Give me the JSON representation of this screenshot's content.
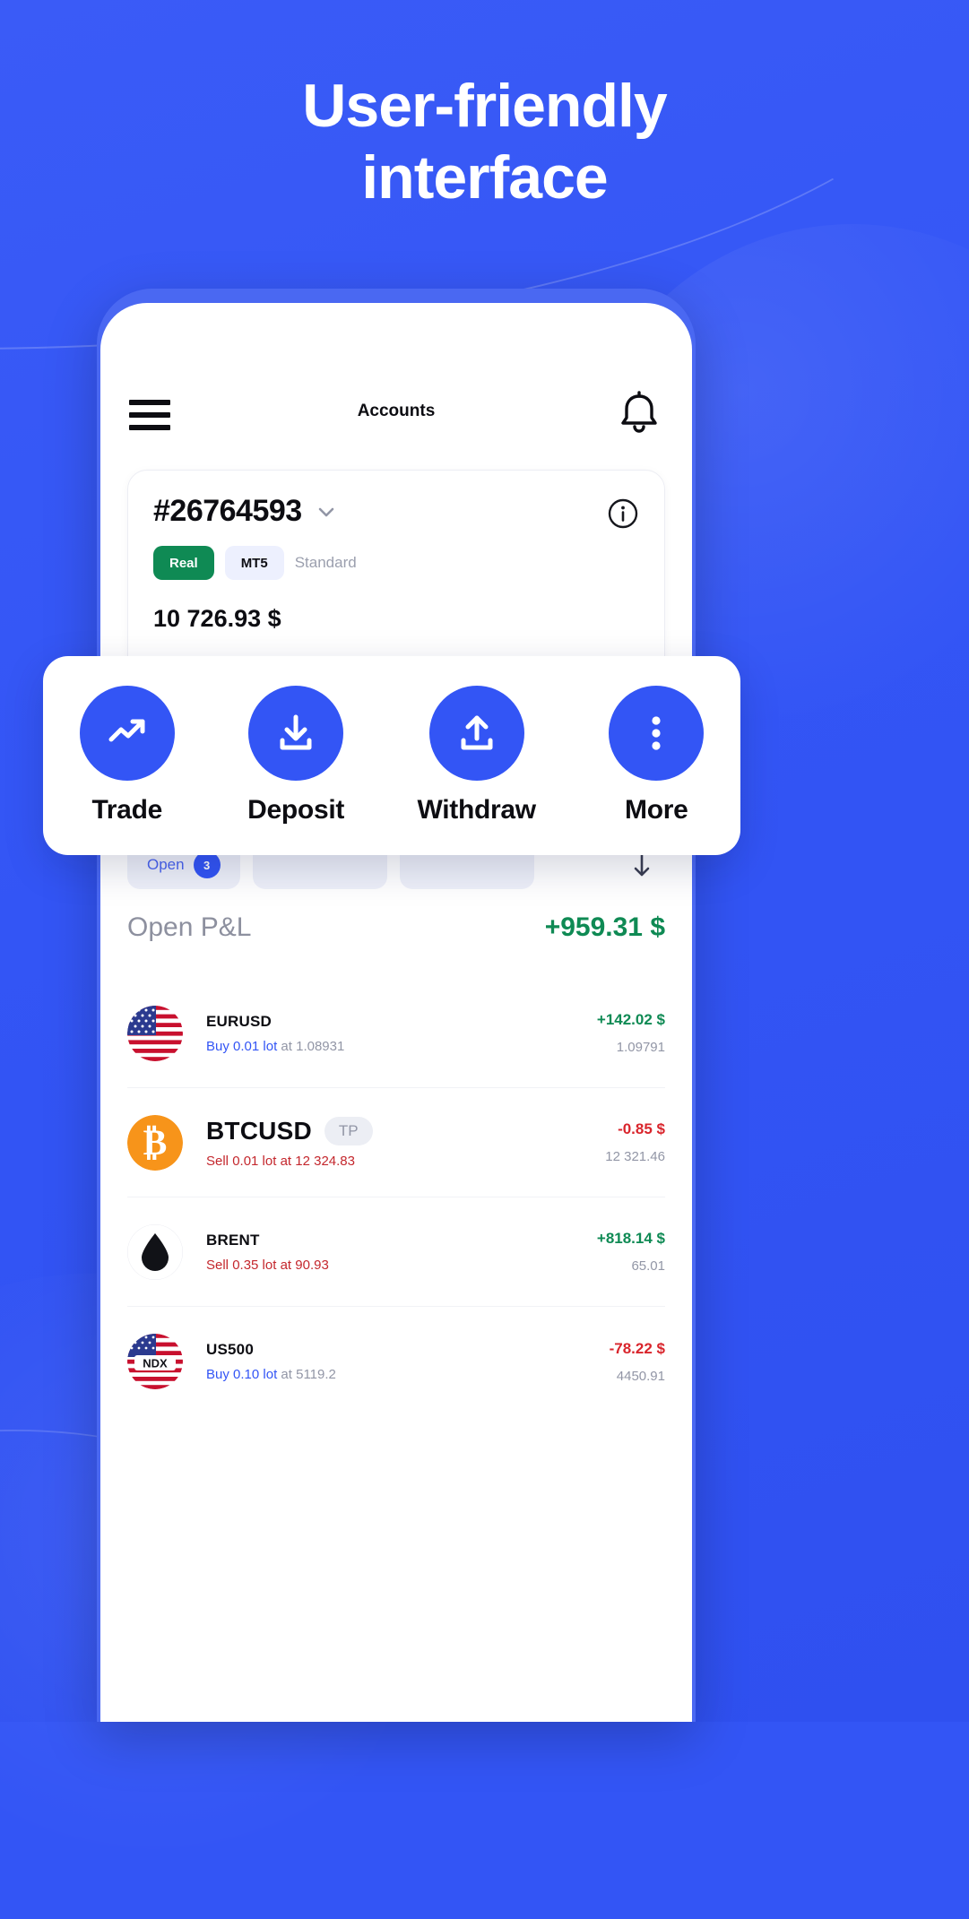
{
  "promo": {
    "headline_line1": "User-friendly",
    "headline_line2": "interface"
  },
  "appbar": {
    "title": "Accounts",
    "menu_icon": "hamburger-menu-icon",
    "bell_icon": "bell-icon"
  },
  "account": {
    "number": "#26764593",
    "chevron_icon": "chevron-down-icon",
    "info_icon": "info-circle-icon",
    "badge_real": "Real",
    "badge_platform": "MT5",
    "badge_type": "Standard",
    "balance": "10 726.93 $"
  },
  "tabs": [
    {
      "label": "Open",
      "count": "3"
    },
    {
      "label": "",
      "count": ""
    },
    {
      "label": "",
      "count": ""
    }
  ],
  "sort_icon": "sort-descending-icon",
  "actions": [
    {
      "label": "Trade",
      "icon": "trending-up-icon"
    },
    {
      "label": "Deposit",
      "icon": "download-icon"
    },
    {
      "label": "Withdraw",
      "icon": "upload-icon"
    },
    {
      "label": "More",
      "icon": "more-vertical-icon"
    }
  ],
  "pnl": {
    "label": "Open P&L",
    "value": "+959.31 $"
  },
  "positions": [
    {
      "symbol": "EURUSD",
      "icon": "us-flag-icon",
      "tag": "",
      "side": "Buy",
      "lots": "0.01 lot",
      "at": "at 1.08931",
      "pl": "+142.02 $",
      "pl_sign": "positive",
      "price": "1.09791",
      "big": false
    },
    {
      "symbol": "BTCUSD",
      "icon": "bitcoin-icon",
      "tag": "TP",
      "side": "Sell",
      "lots": "0.01 lot",
      "at": "at 12 324.83",
      "pl": "-0.85 $",
      "pl_sign": "negative",
      "price": "12 321.46",
      "big": true
    },
    {
      "symbol": "BRENT",
      "icon": "oil-drop-icon",
      "tag": "",
      "side": "Sell",
      "lots": "0.35 lot",
      "at": "at 90.93",
      "pl": "+818.14 $",
      "pl_sign": "positive",
      "price": "65.01",
      "big": false
    },
    {
      "symbol": "US500",
      "icon": "ndx-flag-icon",
      "tag": "",
      "side": "Buy",
      "lots": "0.10 lot",
      "at": "at 5119.2",
      "pl": "-78.22 $",
      "pl_sign": "negative",
      "price": "4450.91",
      "big": false
    }
  ],
  "colors": {
    "brand_blue": "#3355f5",
    "green": "#0f8a54",
    "red": "#d9252c",
    "grey_text": "#9296a6"
  }
}
